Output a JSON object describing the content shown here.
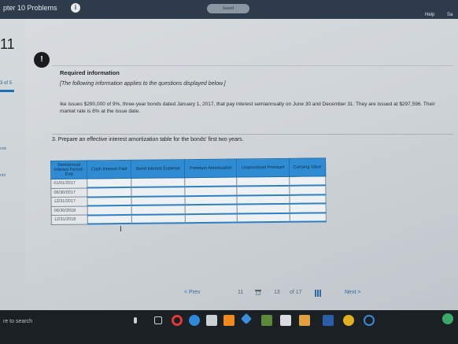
{
  "topbar": {
    "chapter_title": "pter 10 Problems",
    "info_icon": "info-icon",
    "saved_label": "Saved",
    "help_label": "Help",
    "save_label": "Sa"
  },
  "sidebar": {
    "question_number": "11",
    "part_count": "3 of 5",
    "ebook_label": "ook",
    "print_label": "rint"
  },
  "info": {
    "heading": "Required information",
    "note": "[The following information applies to the questions displayed below.]",
    "text": "Ike issues $290,000 of 9%, three-year bonds dated January 1, 2017, that pay interest semiannually on June 30 and December 31. They are issued at $297,596. Their market rate is 8% at the issue date."
  },
  "question": {
    "prompt": "3. Prepare an effective interest amortization table for the bonds' first two years."
  },
  "table": {
    "headers": [
      "Semiannual Interest Period-End",
      "Cash Interest Paid",
      "Bond Interest Expense",
      "Premium Amortization",
      "Unamortized Premium",
      "Carrying Value"
    ],
    "periods": [
      "01/01/2017",
      "06/30/2017",
      "12/31/2017",
      "06/30/2018",
      "12/31/2018"
    ]
  },
  "pager": {
    "prev_label": "< Prev",
    "page_11": "11",
    "page_12": "12",
    "page_13": "13",
    "of_label": "of 17",
    "next_label": "Next >"
  },
  "taskbar": {
    "search_text": "re to search"
  },
  "colors": {
    "topbar": "#2e3b4a",
    "table_header": "#2f8cd2",
    "link": "#2d6aa8",
    "taskbar": "#1b2024"
  }
}
